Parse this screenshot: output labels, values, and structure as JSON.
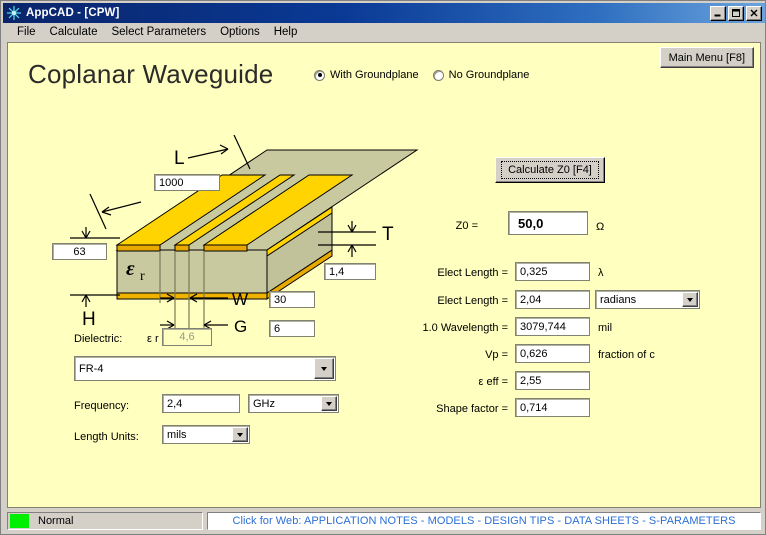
{
  "window": {
    "title": "AppCAD - [CPW]",
    "icon": "appcad-starburst-icon",
    "minimize_label": "minimize-icon",
    "maximize_label": "maximize-icon",
    "close_label": "close-icon"
  },
  "menubar": {
    "items": [
      {
        "label": "File"
      },
      {
        "label": "Calculate"
      },
      {
        "label": "Select Parameters"
      },
      {
        "label": "Options"
      },
      {
        "label": "Help"
      }
    ]
  },
  "header": {
    "page_title": "Coplanar Waveguide",
    "main_menu_label": "Main Menu [F8]",
    "groundplane_options": [
      {
        "label": "With Groundplane",
        "selected": true
      },
      {
        "label": "No Groundplane",
        "selected": false
      }
    ]
  },
  "diagram": {
    "label_L": "L",
    "value_L": "1000",
    "label_H": "H",
    "value_H": "63",
    "label_T": "T",
    "value_T": "1,4",
    "label_W": "W",
    "value_W": "30",
    "label_G": "G",
    "value_G": "6",
    "label_er": "ε",
    "label_er_sub": "r",
    "colors": {
      "conductor_top": "#ffd400",
      "conductor_face": "#e8a900",
      "substrate_top": "#c9c9a0",
      "substrate_face": "#c2c29a",
      "outline": "#000000"
    }
  },
  "calculate": {
    "button_label": "Calculate Z0  [F4]"
  },
  "results": [
    {
      "label": "Z0 =",
      "value": "50,0",
      "unit": "Ω"
    },
    {
      "label": "Elect Length =",
      "value": "0,325",
      "unit": "λ"
    },
    {
      "label": "Elect Length =",
      "value": "2,04",
      "unit": "",
      "combo": "radians"
    },
    {
      "label": "1.0 Wavelength =",
      "value": "3079,744",
      "unit": "mil"
    },
    {
      "label": "Vp =",
      "value": "0,626",
      "unit": "fraction of c"
    },
    {
      "label": "ε eff =",
      "value": "2,55",
      "unit": ""
    },
    {
      "label": "Shape factor =",
      "value": "0,714",
      "unit": ""
    }
  ],
  "results_labels": {
    "z0": "Z0 =",
    "z0_unit": "Ω",
    "elect_length_lambda": "Elect Length =",
    "elect_length_lambda_unit": "λ",
    "elect_length_rad": "Elect Length =",
    "wavelength": "1.0 Wavelength =",
    "wavelength_unit": "mil",
    "vp": "Vp =",
    "vp_unit": "fraction of c",
    "eps_eff": "ε eff =",
    "shape_factor": "Shape factor ="
  },
  "results_values": {
    "z0": "50,0",
    "elect_length_lambda": "0,325",
    "elect_length_rad": "2,04",
    "elect_length_rad_units": "radians",
    "wavelength": "3079,744",
    "vp": "0,626",
    "eps_eff": "2,55",
    "shape_factor": "0,714"
  },
  "inputs": {
    "dielectric_label": "Dielectric:",
    "dielectric_er_label": "ε r =",
    "dielectric_er_value": "4,6",
    "dielectric_material": "FR-4",
    "frequency_label": "Frequency:",
    "frequency_value": "2,4",
    "frequency_units": "GHz",
    "length_units_label": "Length Units:",
    "length_units_value": "mils"
  },
  "statusbar": {
    "mode": "Normal",
    "led_color": "#00ee00",
    "web_link": "Click for Web: APPLICATION NOTES - MODELS - DESIGN TIPS - DATA SHEETS - S-PARAMETERS"
  }
}
